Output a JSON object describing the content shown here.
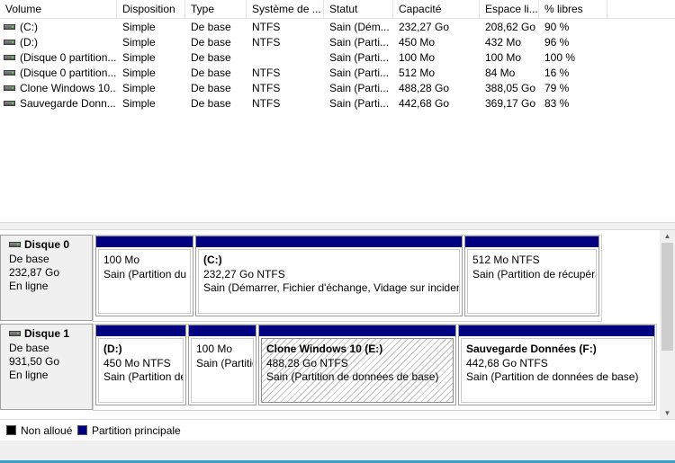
{
  "columns": [
    "Volume",
    "Disposition",
    "Type",
    "Système de ...",
    "Statut",
    "Capacité",
    "Espace li...",
    "% libres"
  ],
  "volumes": [
    {
      "volume": "(C:)",
      "layout": "Simple",
      "type": "De base",
      "fs": "NTFS",
      "status": "Sain (Dém...",
      "capacity": "232,27 Go",
      "free": "208,62 Go",
      "pct": "90 %"
    },
    {
      "volume": "(D:)",
      "layout": "Simple",
      "type": "De base",
      "fs": "NTFS",
      "status": "Sain (Parti...",
      "capacity": "450 Mo",
      "free": "432 Mo",
      "pct": "96 %"
    },
    {
      "volume": "(Disque 0 partition...",
      "layout": "Simple",
      "type": "De base",
      "fs": "",
      "status": "Sain (Parti...",
      "capacity": "100 Mo",
      "free": "100 Mo",
      "pct": "100 %"
    },
    {
      "volume": "(Disque 0 partition...",
      "layout": "Simple",
      "type": "De base",
      "fs": "NTFS",
      "status": "Sain (Parti...",
      "capacity": "512 Mo",
      "free": "84 Mo",
      "pct": "16 %"
    },
    {
      "volume": "Clone Windows 10...",
      "layout": "Simple",
      "type": "De base",
      "fs": "NTFS",
      "status": "Sain (Parti...",
      "capacity": "488,28 Go",
      "free": "388,05 Go",
      "pct": "79 %"
    },
    {
      "volume": "Sauvegarde Donn...",
      "layout": "Simple",
      "type": "De base",
      "fs": "NTFS",
      "status": "Sain (Parti...",
      "capacity": "442,68 Go",
      "free": "369,17 Go",
      "pct": "83 %"
    }
  ],
  "disks": [
    {
      "name": "Disque 0",
      "type": "De base",
      "size": "232,87 Go",
      "state": "En ligne",
      "partitions": [
        {
          "name": "",
          "size": "100 Mo",
          "status": "Sain (Partition du s"
        },
        {
          "name": "(C:)",
          "size": "232,27 Go NTFS",
          "status": "Sain (Démarrer, Fichier d'échange, Vidage sur incident"
        },
        {
          "name": "",
          "size": "512 Mo NTFS",
          "status": "Sain (Partition de récupéra"
        }
      ]
    },
    {
      "name": "Disque 1",
      "type": "De base",
      "size": "931,50 Go",
      "state": "En ligne",
      "partitions": [
        {
          "name": "(D:)",
          "size": "450 Mo NTFS",
          "status": "Sain (Partition de d"
        },
        {
          "name": "",
          "size": "100 Mo",
          "status": "Sain (Partitio"
        },
        {
          "name": "Clone Windows 10  (E:)",
          "size": "488,28 Go NTFS",
          "status": "Sain (Partition de données de base)"
        },
        {
          "name": "Sauvegarde Données  (F:)",
          "size": "442,68 Go NTFS",
          "status": "Sain (Partition de données de base)"
        }
      ]
    }
  ],
  "legend": {
    "unallocated": "Non alloué",
    "primary": "Partition principale"
  },
  "colors": {
    "primary_bar": "#000080",
    "unallocated": "#000000",
    "accent": "#3aa0c8"
  },
  "icons": {
    "drive": "drive-icon",
    "scroll_up": "arrow-up-icon",
    "scroll_down": "arrow-down-icon"
  }
}
